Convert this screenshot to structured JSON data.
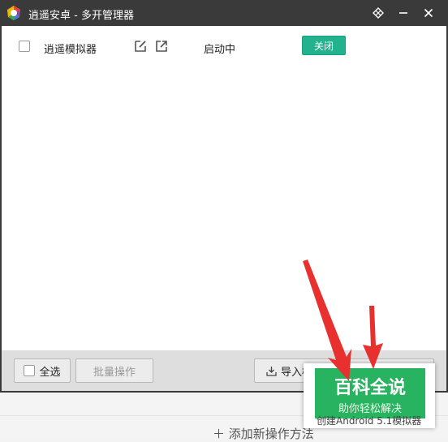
{
  "window": {
    "title": "逍遥安卓 - 多开管理器",
    "icons": [
      "app-logo-icon",
      "pin-icon",
      "minimize-icon",
      "close-icon"
    ]
  },
  "rows": [
    {
      "name": "逍遥模拟器",
      "status": "启动中",
      "action_label": "关闭",
      "icons": [
        "edit-icon",
        "open-external-icon"
      ]
    }
  ],
  "footer": {
    "select_all": "全选",
    "batch": "批量操作",
    "import": "导入模拟",
    "create_hidden": "创建Android 5.1模拟器"
  },
  "below": {
    "add_method": "添加新操作方法"
  },
  "watermark": {
    "title": "百科全说",
    "subtitle": "助你轻松解决"
  },
  "colors": {
    "titlebar": "#3a3a3a",
    "accent_green": "#22b38e",
    "watermark_green": "#27b35f",
    "arrow_red": "#e8312f"
  }
}
